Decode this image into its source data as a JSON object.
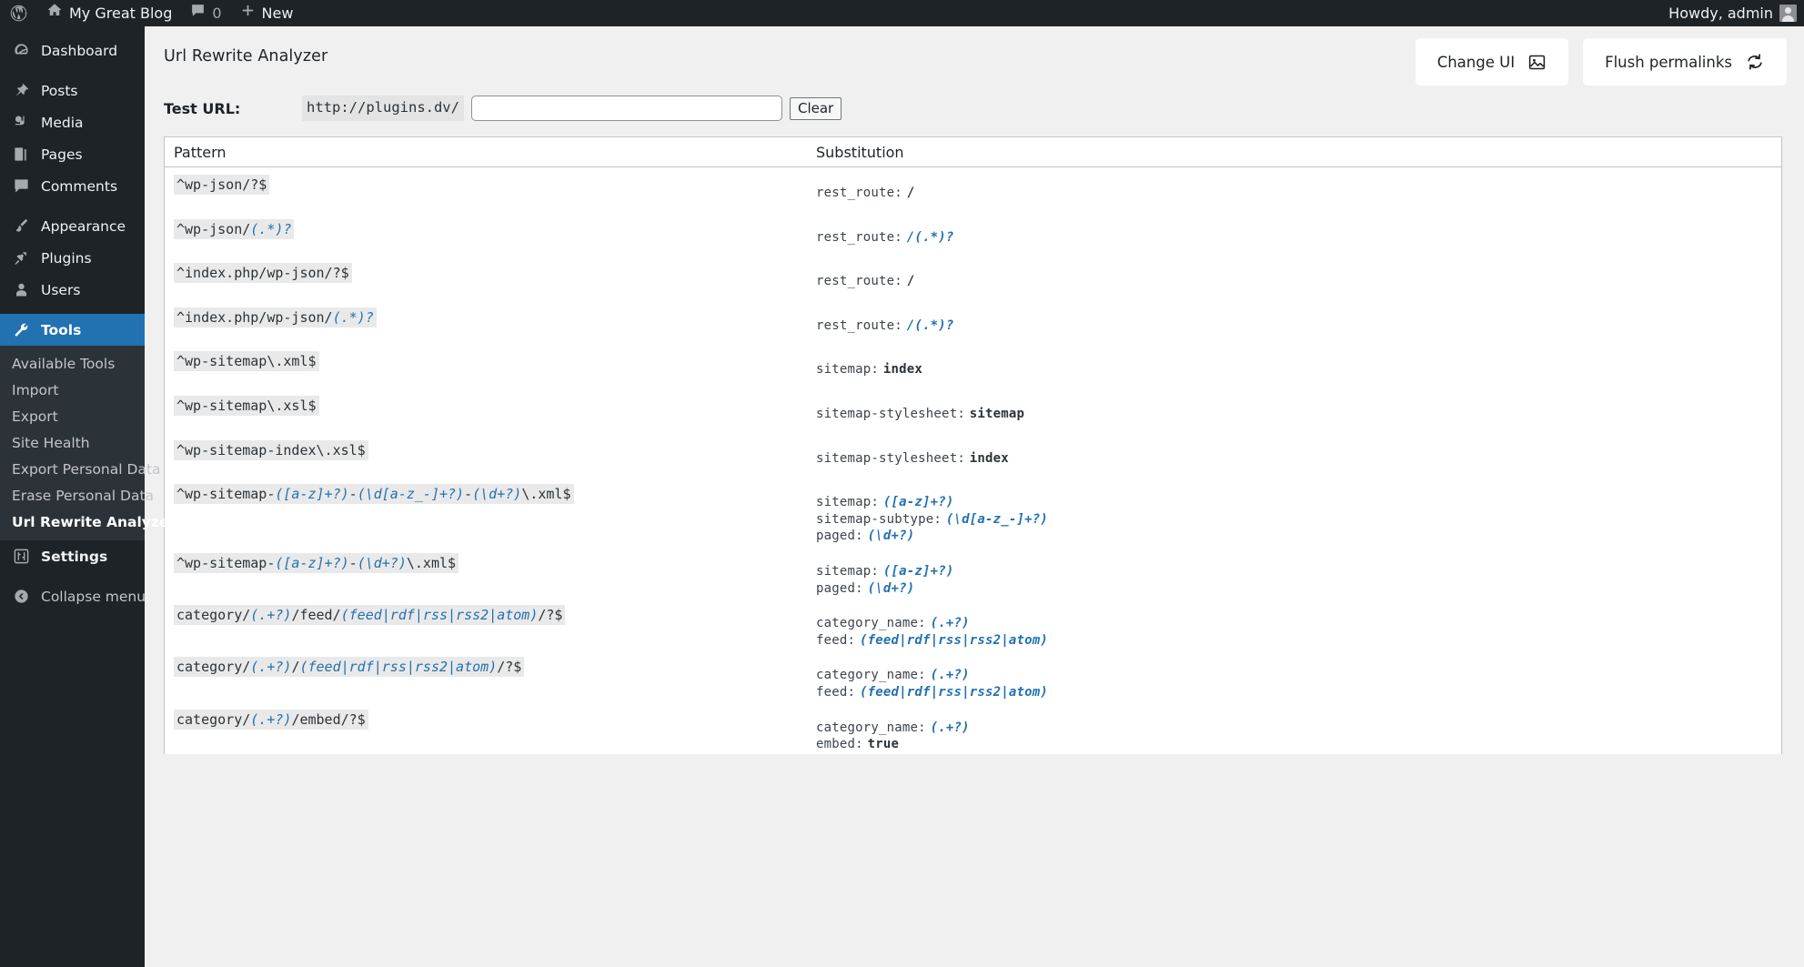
{
  "adminbar": {
    "logo_icon": "wordpress-logo-icon",
    "site_home_icon": "home-icon",
    "site_name": "My Great Blog",
    "comments_icon": "comment-bubble-icon",
    "comments_count": "0",
    "new_icon": "plus-icon",
    "new_label": "New",
    "howdy": "Howdy, admin",
    "avatar_icon": "user-avatar-icon"
  },
  "sidebar": {
    "items": [
      {
        "label": "Dashboard",
        "icon": "dashboard-icon",
        "current": false
      },
      {
        "label": "Posts",
        "icon": "pin-icon",
        "current": false
      },
      {
        "label": "Media",
        "icon": "media-icon",
        "current": false
      },
      {
        "label": "Pages",
        "icon": "pages-icon",
        "current": false
      },
      {
        "label": "Comments",
        "icon": "comment-bubble-icon",
        "current": false
      },
      {
        "label": "Appearance",
        "icon": "brush-icon",
        "current": false
      },
      {
        "label": "Plugins",
        "icon": "plug-icon",
        "current": false
      },
      {
        "label": "Users",
        "icon": "user-icon",
        "current": false
      },
      {
        "label": "Tools",
        "icon": "wrench-icon",
        "current": true
      }
    ],
    "submenu": [
      {
        "label": "Available Tools",
        "current": false
      },
      {
        "label": "Import",
        "current": false
      },
      {
        "label": "Export",
        "current": false
      },
      {
        "label": "Site Health",
        "current": false
      },
      {
        "label": "Export Personal Data",
        "current": false
      },
      {
        "label": "Erase Personal Data",
        "current": false
      },
      {
        "label": "Url Rewrite Analyzer",
        "current": true
      }
    ],
    "settings": {
      "label": "Settings",
      "icon": "settings-sliders-icon"
    },
    "collapse": {
      "label": "Collapse menu",
      "icon": "collapse-arrow-icon"
    }
  },
  "header": {
    "title": "Url Rewrite Analyzer",
    "change_ui_label": "Change UI",
    "change_ui_icon": "image-icon",
    "flush_label": "Flush permalinks",
    "flush_icon": "refresh-icon"
  },
  "testurl": {
    "label": "Test URL:",
    "prefix": "http://plugins.dv/",
    "value": "",
    "placeholder": "",
    "clear_label": "Clear"
  },
  "table": {
    "columns": {
      "pattern": "Pattern",
      "substitution": "Substitution"
    },
    "rows": [
      {
        "pattern": [
          {
            "t": "^wp-json/?$",
            "cap": false
          }
        ],
        "subs": [
          {
            "key": "rest_route:",
            "parts": [
              {
                "t": "/",
                "cap": false
              }
            ]
          }
        ]
      },
      {
        "pattern": [
          {
            "t": "^wp-json/",
            "cap": false
          },
          {
            "t": "(.*)?",
            "cap": true
          }
        ],
        "subs": [
          {
            "key": "rest_route:",
            "parts": [
              {
                "t": "/",
                "cap": true
              },
              {
                "t": "(.*)?",
                "cap": true
              }
            ]
          }
        ]
      },
      {
        "pattern": [
          {
            "t": "^index.php/wp-json/?$",
            "cap": false
          }
        ],
        "subs": [
          {
            "key": "rest_route:",
            "parts": [
              {
                "t": "/",
                "cap": false
              }
            ]
          }
        ]
      },
      {
        "pattern": [
          {
            "t": "^index.php/wp-json/",
            "cap": false
          },
          {
            "t": "(.*)?",
            "cap": true
          }
        ],
        "subs": [
          {
            "key": "rest_route:",
            "parts": [
              {
                "t": "/",
                "cap": true
              },
              {
                "t": "(.*)?",
                "cap": true
              }
            ]
          }
        ]
      },
      {
        "pattern": [
          {
            "t": "^wp-sitemap\\.xml$",
            "cap": false
          }
        ],
        "subs": [
          {
            "key": "sitemap:",
            "parts": [
              {
                "t": "index",
                "cap": false
              }
            ]
          }
        ]
      },
      {
        "pattern": [
          {
            "t": "^wp-sitemap\\.xsl$",
            "cap": false
          }
        ],
        "subs": [
          {
            "key": "sitemap-stylesheet:",
            "parts": [
              {
                "t": "sitemap",
                "cap": false
              }
            ]
          }
        ]
      },
      {
        "pattern": [
          {
            "t": "^wp-sitemap-index\\.xsl$",
            "cap": false
          }
        ],
        "subs": [
          {
            "key": "sitemap-stylesheet:",
            "parts": [
              {
                "t": "index",
                "cap": false
              }
            ]
          }
        ]
      },
      {
        "pattern": [
          {
            "t": "^wp-sitemap-",
            "cap": false
          },
          {
            "t": "([a-z]+?)",
            "cap": true
          },
          {
            "t": "-",
            "cap": false
          },
          {
            "t": "(\\d[a-z_-]+?)",
            "cap": true
          },
          {
            "t": "-",
            "cap": false
          },
          {
            "t": "(\\d+?)",
            "cap": true
          },
          {
            "t": "\\.xml$",
            "cap": false
          }
        ],
        "subs": [
          {
            "key": "sitemap:",
            "parts": [
              {
                "t": "([a-z]+?)",
                "cap": true
              }
            ]
          },
          {
            "key": "sitemap-subtype:",
            "parts": [
              {
                "t": "(\\d[a-z_-]+?)",
                "cap": true
              }
            ]
          },
          {
            "key": "paged:",
            "parts": [
              {
                "t": "(\\d+?)",
                "cap": true
              }
            ]
          }
        ]
      },
      {
        "pattern": [
          {
            "t": "^wp-sitemap-",
            "cap": false
          },
          {
            "t": "([a-z]+?)",
            "cap": true
          },
          {
            "t": "-",
            "cap": false
          },
          {
            "t": "(\\d+?)",
            "cap": true
          },
          {
            "t": "\\.xml$",
            "cap": false
          }
        ],
        "subs": [
          {
            "key": "sitemap:",
            "parts": [
              {
                "t": "([a-z]+?)",
                "cap": true
              }
            ]
          },
          {
            "key": "paged:",
            "parts": [
              {
                "t": "(\\d+?)",
                "cap": true
              }
            ]
          }
        ]
      },
      {
        "pattern": [
          {
            "t": "category/",
            "cap": false
          },
          {
            "t": "(.+?)",
            "cap": true
          },
          {
            "t": "/feed/",
            "cap": false
          },
          {
            "t": "(feed|rdf|rss|rss2|atom)",
            "cap": true
          },
          {
            "t": "/?$",
            "cap": false
          }
        ],
        "subs": [
          {
            "key": "category_name:",
            "parts": [
              {
                "t": "(.+?)",
                "cap": true
              }
            ]
          },
          {
            "key": "feed:",
            "parts": [
              {
                "t": "(feed|rdf|rss|rss2|atom)",
                "cap": true
              }
            ]
          }
        ]
      },
      {
        "pattern": [
          {
            "t": "category/",
            "cap": false
          },
          {
            "t": "(.+?)",
            "cap": true
          },
          {
            "t": "/",
            "cap": false
          },
          {
            "t": "(feed|rdf|rss|rss2|atom)",
            "cap": true
          },
          {
            "t": "/?$",
            "cap": false
          }
        ],
        "subs": [
          {
            "key": "category_name:",
            "parts": [
              {
                "t": "(.+?)",
                "cap": true
              }
            ]
          },
          {
            "key": "feed:",
            "parts": [
              {
                "t": "(feed|rdf|rss|rss2|atom)",
                "cap": true
              }
            ]
          }
        ]
      },
      {
        "pattern": [
          {
            "t": "category/",
            "cap": false
          },
          {
            "t": "(.+?)",
            "cap": true
          },
          {
            "t": "/embed/?$",
            "cap": false
          }
        ],
        "subs": [
          {
            "key": "category_name:",
            "parts": [
              {
                "t": "(.+?)",
                "cap": true
              }
            ]
          },
          {
            "key": "embed:",
            "parts": [
              {
                "t": "true",
                "cap": false
              }
            ]
          }
        ]
      }
    ]
  },
  "colors": {
    "admin_dark": "#1d2327",
    "admin_submenu": "#2c3338",
    "accent_blue": "#2271b1",
    "page_bg": "#f0f0f1",
    "code_bg": "#e9e9e9"
  }
}
